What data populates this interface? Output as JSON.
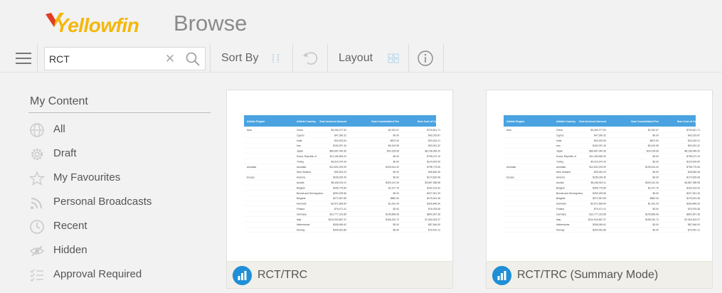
{
  "app": {
    "logo_text": "Yellowfin",
    "page_title": "Browse"
  },
  "toolbar": {
    "search_value": "RCT",
    "sort_label": "Sort By",
    "layout_label": "Layout"
  },
  "sidebar": {
    "title": "My Content",
    "items": [
      {
        "label": "All",
        "icon": "globe-icon"
      },
      {
        "label": "Draft",
        "icon": "gear-icon"
      },
      {
        "label": "My Favourites",
        "icon": "star-icon"
      },
      {
        "label": "Personal Broadcasts",
        "icon": "rss-icon"
      },
      {
        "label": "Recent",
        "icon": "clock-icon"
      },
      {
        "label": "Hidden",
        "icon": "eye-slash-icon"
      },
      {
        "label": "Approval Required",
        "icon": "checklist-icon"
      }
    ]
  },
  "cards": [
    {
      "name": "RCT/TRC"
    },
    {
      "name": "RCT/TRC (Summary Mode)"
    }
  ],
  "report_preview": {
    "headers": [
      "Athlete Region",
      "Athlete Country",
      "Sum Invoiced Amount",
      "Sum Consolidated Fee",
      "Sum Cost of Camp"
    ],
    "rows": [
      [
        "Asia",
        "China",
        "$3,260,277.52",
        "$2,322.67",
        "$700,621.71"
      ],
      [
        "",
        "Cyprus",
        "$47,390.32",
        "$0.00",
        "$42,019.87"
      ],
      [
        "",
        "India",
        "$34,923.54",
        "$872.00",
        "$23,334.21"
      ],
      [
        "",
        "Iran",
        "$152,097.40",
        "$5,100.95",
        "$93,091.32"
      ],
      [
        "",
        "Japan",
        "$66,687,044.36",
        "$24,199.08",
        "$8,108,348.20"
      ],
      [
        "",
        "Korea, Republic of",
        "$11,183,963.20",
        "$0.00",
        "$798,072.10"
      ],
      [
        "",
        "Turkey",
        "$4,219,374.34",
        "$0.00",
        "$124,003.50"
      ],
      [
        "Australia",
        "Australia",
        "$12,602,229.09",
        "$199,514.42",
        "$798,775.06"
      ],
      [
        "",
        "New Zealand",
        "$39,281.03",
        "$0.00",
        "$45,846.36"
      ],
      [
        "Europe",
        "Andorra",
        "$235,029.40",
        "$0.00",
        "$174,529.08"
      ],
      [
        "",
        "Austria",
        "$5,448,915.11",
        "$329,142.26",
        "$3,887,398.98"
      ],
      [
        "",
        "Belgium",
        "$256,775.89",
        "$2,147.76",
        "$160,103.32"
      ],
      [
        "",
        "Bosnia and Herzegovina",
        "$290,029.56",
        "$0.00",
        "$227,941.33"
      ],
      [
        "",
        "Bulgaria",
        "$272,367.89",
        "$882.53",
        "$178,261.36"
      ],
      [
        "",
        "Denmark",
        "$2,571,569.84",
        "$1,091.43",
        "$326,846.30"
      ],
      [
        "",
        "Finland",
        "$79,471.41",
        "$0.00",
        "$76,978.08"
      ],
      [
        "",
        "Germany",
        "$12,777,219.85",
        "$145,896.08",
        "$800,357.36"
      ],
      [
        "",
        "Italy",
        "$110,943,587.37",
        "$198,232.72",
        "$7,063,303.37"
      ],
      [
        "",
        "Netherlands",
        "$308,069.62",
        "$0.00",
        "$87,546.00"
      ],
      [
        "",
        "Norway",
        "$309,061.86",
        "$0.00",
        "$79,442.12"
      ]
    ],
    "colors": {
      "header_bg": "#4aa3e0",
      "header_text": "#ffffff"
    }
  },
  "colors": {
    "brand_yellow": "#f4b70a",
    "accent_blue": "#1f8fd6"
  }
}
